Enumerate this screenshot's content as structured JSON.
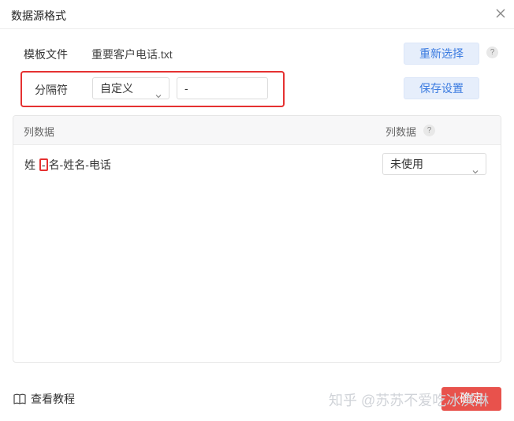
{
  "window": {
    "title": "数据源格式"
  },
  "template": {
    "label": "模板文件",
    "file_name": "重要客户电话.txt",
    "reselect_label": "重新选择",
    "help": "?"
  },
  "separator": {
    "label": "分隔符",
    "mode_value": "自定义",
    "custom_value": "-",
    "save_label": "保存设置"
  },
  "table": {
    "col_data_header": "列数据",
    "col_type_header": "列数据",
    "col_type_help": "?",
    "rows": [
      {
        "text_before": "姓",
        "separator": "-",
        "text_after": "名-姓名-电话",
        "usage": "未使用"
      }
    ]
  },
  "footer": {
    "tutorial_label": "查看教程",
    "confirm_label": "确定",
    "watermark": "知乎 @苏苏不爱吃冰淇淋"
  },
  "colors": {
    "accent": "#3b7be0",
    "highlight": "#e53131",
    "confirm": "#e8524c"
  },
  "icons": {
    "close": "close-icon",
    "dropdown": "chevron-down-icon",
    "book": "book-icon"
  }
}
